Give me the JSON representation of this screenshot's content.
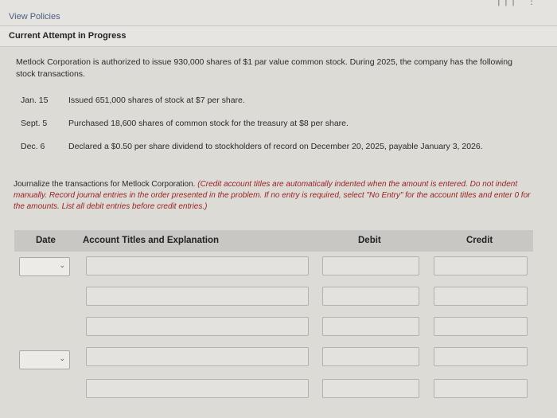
{
  "header": {
    "view_policies": "View Policies",
    "attempt": "Current Attempt in Progress",
    "icons": [
      "menu-icon",
      "more-icon"
    ]
  },
  "problem": {
    "intro": "Metlock Corporation is authorized to issue 930,000 shares of $1 par value common stock. During 2025, the company has the following stock transactions.",
    "transactions": [
      {
        "date": "Jan. 15",
        "text": "Issued 651,000 shares of stock at $7 per share."
      },
      {
        "date": "Sept. 5",
        "text": "Purchased 18,600 shares of common stock for the treasury at $8 per share."
      },
      {
        "date": "Dec. 6",
        "text": "Declared a $0.50 per share dividend to stockholders of record on December 20, 2025, payable January 3, 2026."
      }
    ],
    "instruction_lead": "Journalize the transactions for Metlock Corporation. ",
    "instruction_note": "(Credit account titles are automatically indented when the amount is entered. Do not indent manually. Record journal entries in the order presented in the problem. If no entry is required, select \"No Entry\" for the account titles and enter 0 for the amounts. List all debit entries before credit entries.)"
  },
  "table": {
    "headers": {
      "date": "Date",
      "account": "Account Titles and Explanation",
      "debit": "Debit",
      "credit": "Credit"
    },
    "rows": [
      {
        "date_value": "",
        "account_value": "",
        "debit_value": "",
        "credit_value": ""
      },
      {
        "account_value": "",
        "debit_value": "",
        "credit_value": ""
      },
      {
        "account_value": "",
        "debit_value": "",
        "credit_value": ""
      },
      {
        "date_value": "",
        "account_value": "",
        "debit_value": "",
        "credit_value": ""
      },
      {
        "account_value": "",
        "debit_value": "",
        "credit_value": ""
      }
    ]
  }
}
